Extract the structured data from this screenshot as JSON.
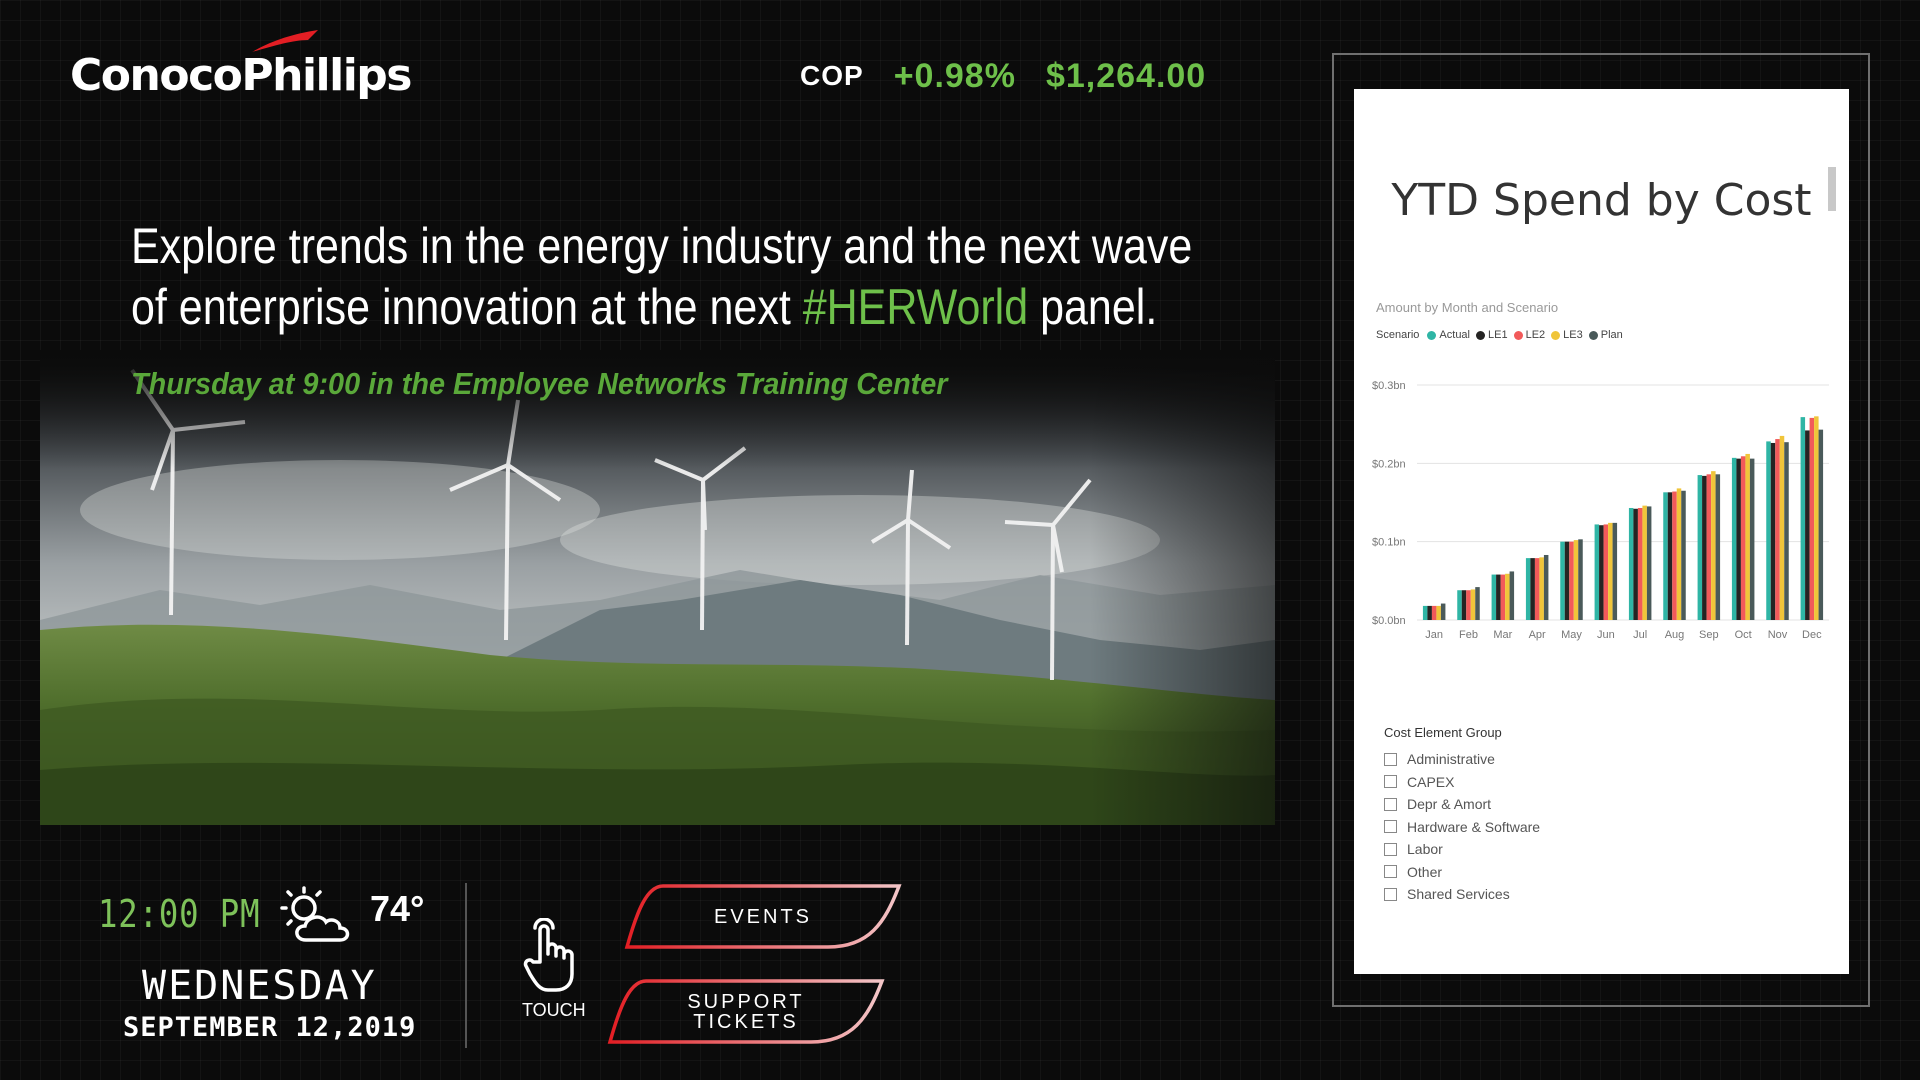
{
  "brand": {
    "name": "ConocoPhillips",
    "logo_color": "#e31e24"
  },
  "ticker": {
    "symbol": "COP",
    "change": "+0.98%",
    "price": "$1,264.00",
    "color": "#6ec04a"
  },
  "headline": {
    "line1": "Explore trends in the energy industry and the next wave",
    "line2_pre": "of enterprise innovation at the next ",
    "hashtag": "#HERWorld",
    "line2_post": " panel.",
    "subline": "Thursday at 9:00 in the Employee Networks Training Center"
  },
  "status": {
    "time": "12:00 PM",
    "weather_icon": "partly-cloudy-icon",
    "temperature": "74°",
    "weekday": "WEDNESDAY",
    "date": "SEPTEMBER 12,2019"
  },
  "touch": {
    "label": "TOUCH",
    "icon": "hand-pointer-icon"
  },
  "buttons": {
    "events": "EVENTS",
    "support": "SUPPORT TICKETS"
  },
  "dashboard": {
    "title": "YTD Spend by Cost",
    "subtitle": "Amount by Month and Scenario",
    "filter_title": "Cost Element Group",
    "filters": [
      "Administrative",
      "CAPEX",
      "Depr & Amort",
      "Hardware & Software",
      "Labor",
      "Other",
      "Shared Services"
    ]
  },
  "chart_data": {
    "type": "bar",
    "title": "YTD Spend by Cost",
    "subtitle": "Amount by Month and Scenario",
    "legend_title": "Scenario",
    "legend_position": "top-left",
    "ylim": [
      0,
      0.3
    ],
    "y_ticks": [
      "$0.0bn",
      "$0.1bn",
      "$0.2bn",
      "$0.3bn"
    ],
    "grid": true,
    "categories": [
      "Jan",
      "Feb",
      "Mar",
      "Apr",
      "May",
      "Jun",
      "Jul",
      "Aug",
      "Sep",
      "Oct",
      "Nov",
      "Dec"
    ],
    "series": [
      {
        "name": "Actual",
        "color": "#2fb5a5",
        "values": [
          0.018,
          0.038,
          0.058,
          0.079,
          0.1,
          0.122,
          0.143,
          0.163,
          0.185,
          0.207,
          0.228,
          0.259
        ]
      },
      {
        "name": "LE1",
        "color": "#252423",
        "values": [
          0.018,
          0.038,
          0.058,
          0.079,
          0.1,
          0.121,
          0.142,
          0.163,
          0.184,
          0.206,
          0.226,
          0.242
        ]
      },
      {
        "name": "LE2",
        "color": "#f25a5a",
        "values": [
          0.018,
          0.038,
          0.058,
          0.079,
          0.1,
          0.122,
          0.143,
          0.164,
          0.186,
          0.209,
          0.231,
          0.258
        ]
      },
      {
        "name": "LE3",
        "color": "#f0c53a",
        "values": [
          0.018,
          0.039,
          0.059,
          0.08,
          0.102,
          0.124,
          0.146,
          0.168,
          0.19,
          0.212,
          0.235,
          0.26
        ]
      },
      {
        "name": "Plan",
        "color": "#4a5a5a",
        "values": [
          0.021,
          0.042,
          0.062,
          0.083,
          0.103,
          0.124,
          0.145,
          0.165,
          0.186,
          0.206,
          0.227,
          0.243
        ]
      }
    ]
  }
}
